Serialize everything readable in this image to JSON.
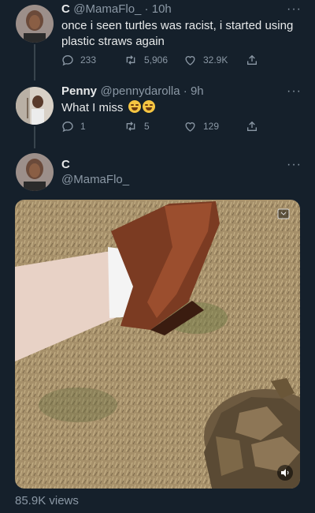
{
  "tweets": [
    {
      "name": "C",
      "handle": "@MamaFlo_",
      "time": "10h",
      "text": "once i seen turtles was racist, i started using plastic straws again",
      "replies": "233",
      "retweets": "5,906",
      "likes": "32.9K",
      "more": "···"
    },
    {
      "name": "Penny",
      "handle": "@pennydarolla",
      "time": "9h",
      "text": "What I miss",
      "replies": "1",
      "retweets": "5",
      "likes": "129",
      "more": "···"
    }
  ],
  "main_tweet": {
    "name": "C",
    "handle": "@MamaFlo_",
    "more": "···",
    "views": "85.9K views"
  },
  "separator": " · ",
  "icons": [
    "reply-icon",
    "retweet-icon",
    "like-icon",
    "share-icon",
    "fullscreen-icon",
    "volume-icon"
  ],
  "colors": {
    "background": "#15202b",
    "secondary_text": "#8b98a5"
  }
}
